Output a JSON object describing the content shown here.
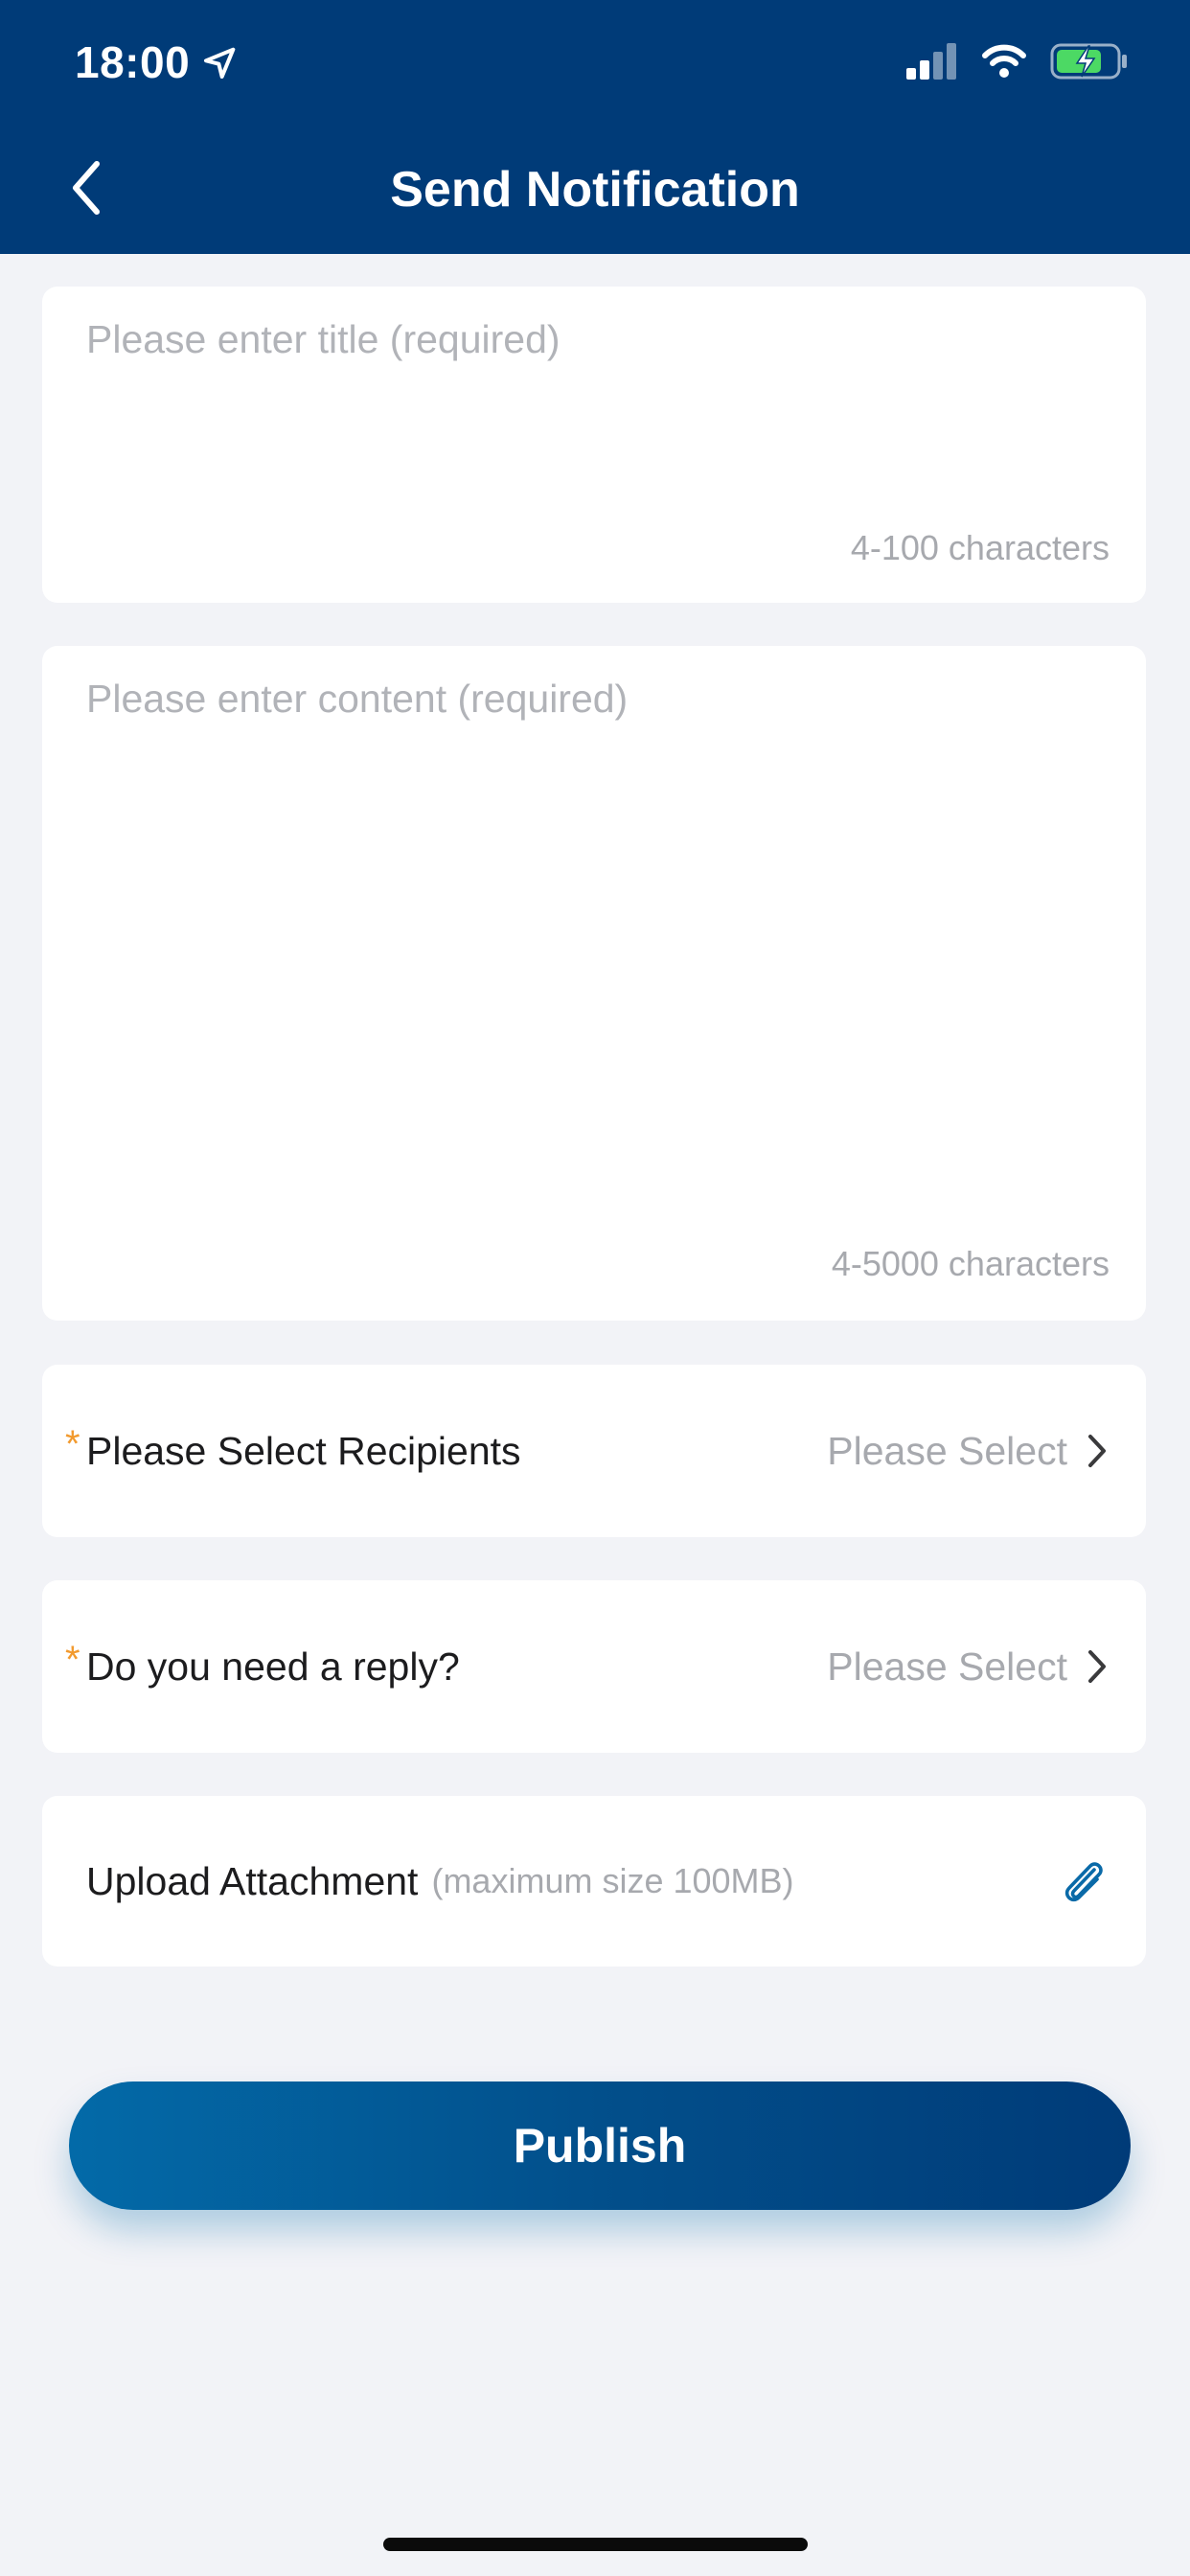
{
  "status_bar": {
    "time": "18:00"
  },
  "nav": {
    "title": "Send Notification"
  },
  "title_field": {
    "placeholder": "Please enter title (required)",
    "char_limit": "4-100 characters"
  },
  "content_field": {
    "placeholder": "Please enter content (required)",
    "char_limit": "4-5000 characters"
  },
  "recipients": {
    "required_mark": "*",
    "label": "Please Select Recipients",
    "value": "Please Select"
  },
  "reply": {
    "required_mark": "*",
    "label": "Do you need a reply?",
    "value": "Please Select"
  },
  "attachment": {
    "label": "Upload Attachment",
    "hint": "(maximum size 100MB)",
    "icon": "paperclip-icon"
  },
  "publish_button": {
    "label": "Publish"
  },
  "colors": {
    "header_bg": "#003b78",
    "page_bg": "#f2f3f7",
    "required_mark": "#f29a2e",
    "button_gradient_start": "#036aa8",
    "button_gradient_end": "#003b78",
    "accent_icon": "#0a6aa8",
    "battery_fill": "#4cd964"
  }
}
